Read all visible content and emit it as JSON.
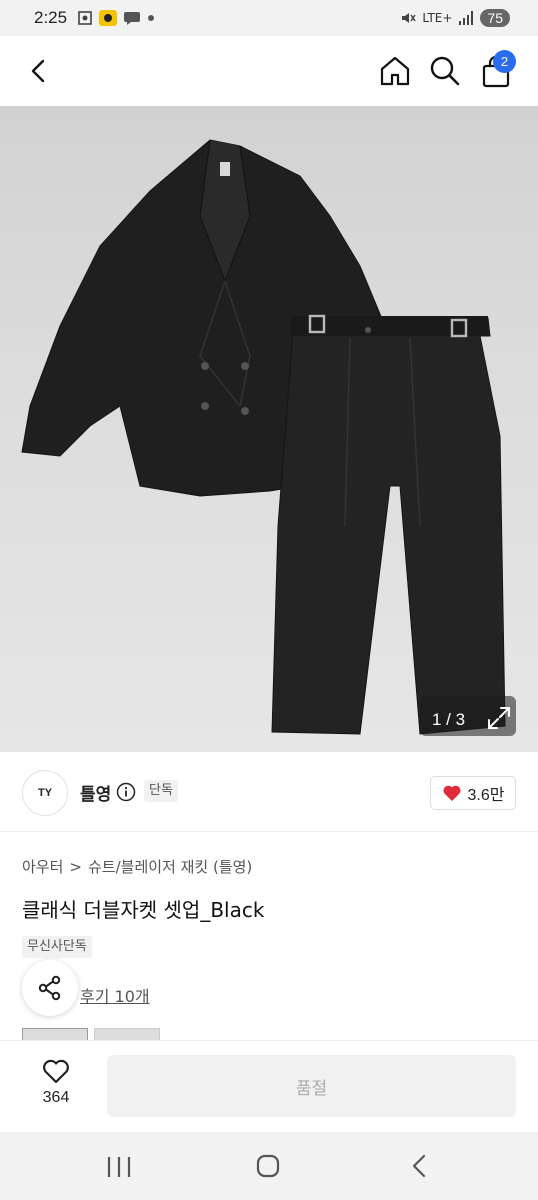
{
  "status_bar": {
    "time": "2:25",
    "network": "LTE+",
    "battery": "75"
  },
  "header": {
    "cart_count": "2",
    "icons": [
      "back-icon",
      "home-icon",
      "search-icon",
      "shopping-bag-icon"
    ]
  },
  "gallery": {
    "counter": "1 / 3"
  },
  "brand": {
    "logo_text": "TY",
    "name": "틀영",
    "exclusive_tag": "단독",
    "likes": "3.6만"
  },
  "product": {
    "breadcrumb_category": "아우터",
    "breadcrumb_separator": ">",
    "breadcrumb_sub": "슈트/블레이저 재킷 (틀영)",
    "title": "클래식 더블자켓 셋업_Black",
    "exclusive_label": "무신사단독",
    "reviews": "후기 10개"
  },
  "purchase_bar": {
    "wish_count": "364",
    "soldout_label": "품절"
  },
  "colors": {
    "accent_blue": "#2a6cf0",
    "heart_red": "#e02c38"
  }
}
